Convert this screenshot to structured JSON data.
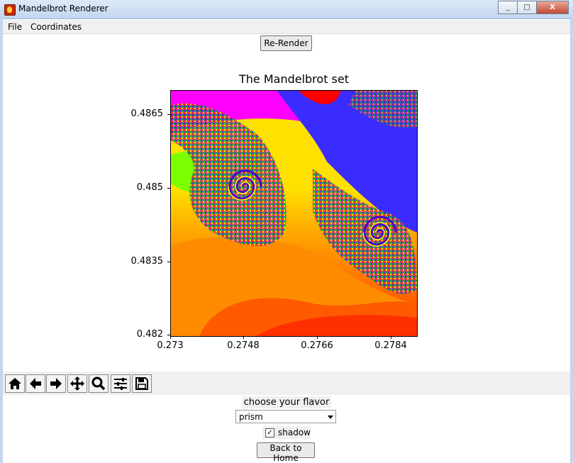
{
  "window": {
    "title": "Mandelbrot Renderer",
    "controls": [
      "_",
      "□",
      "X"
    ]
  },
  "menu": {
    "items": [
      "File",
      "Coordinates"
    ]
  },
  "rerender_label": "Re-Render",
  "plot": {
    "title": "The Mandelbrot set",
    "y_ticks": [
      "0.4865",
      "0.485",
      "0.4835",
      "0.482"
    ],
    "x_ticks": [
      "0.273",
      "0.2748",
      "0.2766",
      "0.2784"
    ],
    "xlim": [
      0.273,
      0.2786
    ],
    "ylim": [
      0.482,
      0.4868
    ],
    "colormap": "prism"
  },
  "toolbar": {
    "tools": [
      "home-icon",
      "back-icon",
      "forward-icon",
      "pan-icon",
      "zoom-icon",
      "configure-icon",
      "save-icon"
    ]
  },
  "flavor": {
    "label": "choose your flavor",
    "selected": "prism"
  },
  "shadow": {
    "label": "shadow",
    "checked": true
  },
  "home_label": "Back to Home"
}
